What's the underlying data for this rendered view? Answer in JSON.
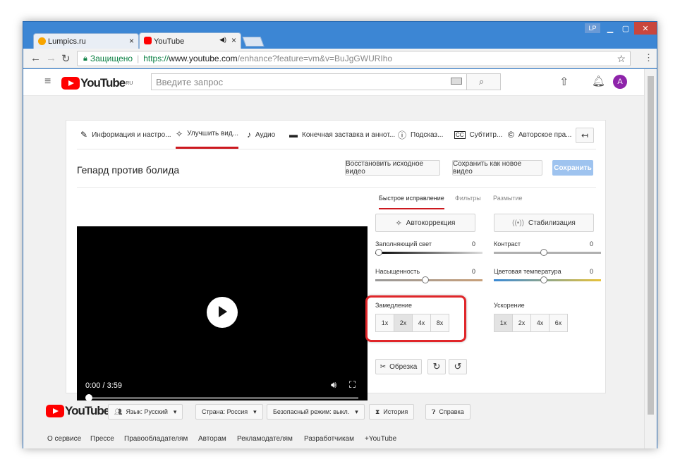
{
  "browser": {
    "tabs": [
      {
        "label": "Lumpics.ru",
        "close": "×"
      },
      {
        "label": "YouTube",
        "close": "×",
        "audio": "◀)"
      }
    ],
    "profile_badge": "LP",
    "secure_label": "Защищено",
    "url_prefix": "https://",
    "url_host": "www.youtube.com",
    "url_path": "/enhance?feature=vm&v=BuJgGWURIho"
  },
  "header": {
    "logo": "YouTube",
    "region": "RU",
    "search_placeholder": "Введите запрос",
    "avatar_letter": "A"
  },
  "editor": {
    "tabs": [
      {
        "label": "Информация и настро...",
        "icon": "pencil-icon"
      },
      {
        "label": "Улучшить вид...",
        "icon": "magic-wand-icon"
      },
      {
        "label": "Аудио",
        "icon": "music-note-icon"
      },
      {
        "label": "Конечная заставка и аннот...",
        "icon": "end-screen-icon"
      },
      {
        "label": "Подсказ...",
        "icon": "info-icon"
      },
      {
        "label": "Субтитр...",
        "icon": "cc-icon"
      },
      {
        "label": "Авторское пра...",
        "icon": "copyright-icon"
      }
    ],
    "back_arrow": "↤",
    "title": "Гепард против болида",
    "restore_label": "Восстановить исходное видео",
    "save_new_label": "Сохранить как новое видео",
    "save_label": "Сохранить",
    "player": {
      "time": "0:00 / 3:59",
      "progress": 0
    },
    "subtabs": [
      "Быстрое исправление",
      "Фильтры",
      "Размытие"
    ],
    "autocorrect_label": "Автокоррекция",
    "stabilize_label": "Стабилизация",
    "sliders": [
      {
        "label": "Заполняющий свет",
        "value": "0",
        "level": 0
      },
      {
        "label": "Контраст",
        "value": "0",
        "level": 0.5
      },
      {
        "label": "Насыщенность",
        "value": "0",
        "level": 0.5
      },
      {
        "label": "Цветовая температура",
        "value": "0",
        "level": 0.5
      }
    ],
    "slowdown": {
      "label": "Замедление",
      "options": [
        "1x",
        "2x",
        "4x",
        "8x"
      ],
      "selected": "2x"
    },
    "speedup": {
      "label": "Ускорение",
      "options": [
        "1x",
        "2x",
        "4x",
        "6x"
      ],
      "selected": "1x"
    },
    "trim_label": "Обрезка",
    "highlight_color": "#e0262a"
  },
  "footer": {
    "logo": "YouTube",
    "language": "Язык: Русский",
    "country": "Страна: Россия",
    "safe_mode": "Безопасный режим: выкл.",
    "history": "История",
    "help": "Справка",
    "links": [
      "О сервисе",
      "Прессе",
      "Правообладателям",
      "Авторам",
      "Рекламодателям",
      "Разработчикам",
      "+YouTube"
    ]
  },
  "colors": {
    "brand_red": "#ff0000",
    "titlebar": "#3c86d4",
    "save_btn": "#9ec3ef",
    "active_tab_underline": "#cc181e"
  }
}
